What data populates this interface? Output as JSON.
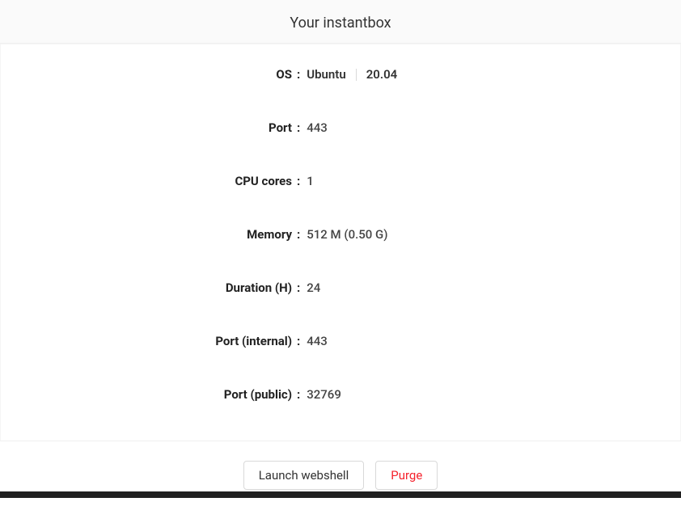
{
  "header": {
    "title": "Your instantbox"
  },
  "details": {
    "os_label": "OS",
    "os_name": "Ubuntu",
    "os_version": "20.04",
    "port_label": "Port",
    "port_value": "443",
    "cpu_label": "CPU cores",
    "cpu_value": "1",
    "memory_label": "Memory",
    "memory_value": "512 M  (0.50 G)",
    "duration_label": "Duration (H)",
    "duration_value": "24",
    "port_internal_label": "Port (internal)",
    "port_internal_value": "443",
    "port_public_label": "Port (public)",
    "port_public_value": "32769"
  },
  "buttons": {
    "launch": "Launch webshell",
    "purge": "Purge"
  }
}
